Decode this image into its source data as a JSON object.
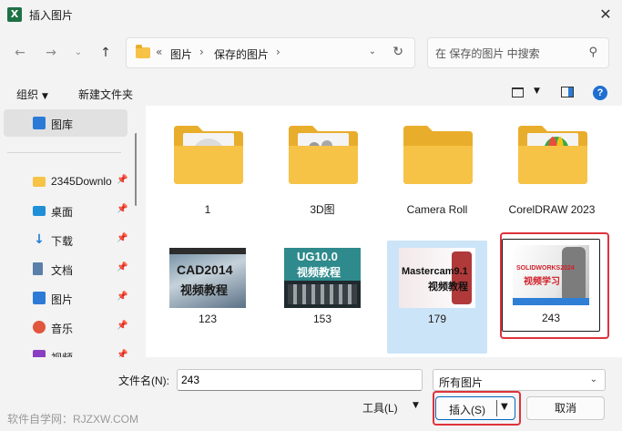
{
  "window": {
    "app_icon_letter": "X",
    "title": "插入图片",
    "close_glyph": "✕"
  },
  "nav": {
    "address_prefix": "«",
    "breadcrumb": [
      "图片",
      "保存的图片"
    ],
    "search_placeholder": "在 保存的图片 中搜索"
  },
  "toolbar": {
    "organize_label": "组织",
    "new_folder_label": "新建文件夹",
    "help_label": "?"
  },
  "sidebar": {
    "items": [
      {
        "label": "图库",
        "icon": "gallery-icon",
        "active": true,
        "pinned": false
      },
      {
        "label": "2345Downlo",
        "icon": "folder-icon",
        "active": false,
        "pinned": true
      },
      {
        "label": "桌面",
        "icon": "desktop-icon",
        "active": false,
        "pinned": true
      },
      {
        "label": "下载",
        "icon": "download-icon",
        "active": false,
        "pinned": true
      },
      {
        "label": "文档",
        "icon": "document-icon",
        "active": false,
        "pinned": true
      },
      {
        "label": "图片",
        "icon": "pictures-icon",
        "active": false,
        "pinned": true
      },
      {
        "label": "音乐",
        "icon": "music-icon",
        "active": false,
        "pinned": true
      },
      {
        "label": "视频",
        "icon": "video-icon",
        "active": false,
        "pinned": true
      }
    ]
  },
  "files": [
    {
      "name": "1",
      "type": "folder"
    },
    {
      "name": "3D图",
      "type": "folder"
    },
    {
      "name": "Camera Roll",
      "type": "folder"
    },
    {
      "name": "CorelDRAW 2023",
      "type": "folder"
    },
    {
      "name": "123",
      "type": "image",
      "thumb_text": "CAD2014",
      "thumb_sub": "视频教程"
    },
    {
      "name": "153",
      "type": "image",
      "thumb_text": "UG10.0",
      "thumb_sub": "视频教程"
    },
    {
      "name": "179",
      "type": "image",
      "thumb_text": "Mastercam9.1",
      "thumb_sub": "视频教程"
    },
    {
      "name": "243",
      "type": "image",
      "thumb_text": "SOLIDWORKS2024",
      "thumb_sub": "视频学习",
      "selected": true
    }
  ],
  "footer": {
    "filename_label": "文件名(N):",
    "filename_value": "243",
    "filetype_value": "所有图片",
    "tools_label": "工具(L)",
    "insert_label": "插入(S)",
    "cancel_label": "取消",
    "watermark": "软件自学网：RJZXW.COM"
  },
  "colors": {
    "accent": "#0067c0",
    "highlight_red": "#e0323a",
    "selection": "#cce4f7",
    "folder": "#f6c347"
  }
}
